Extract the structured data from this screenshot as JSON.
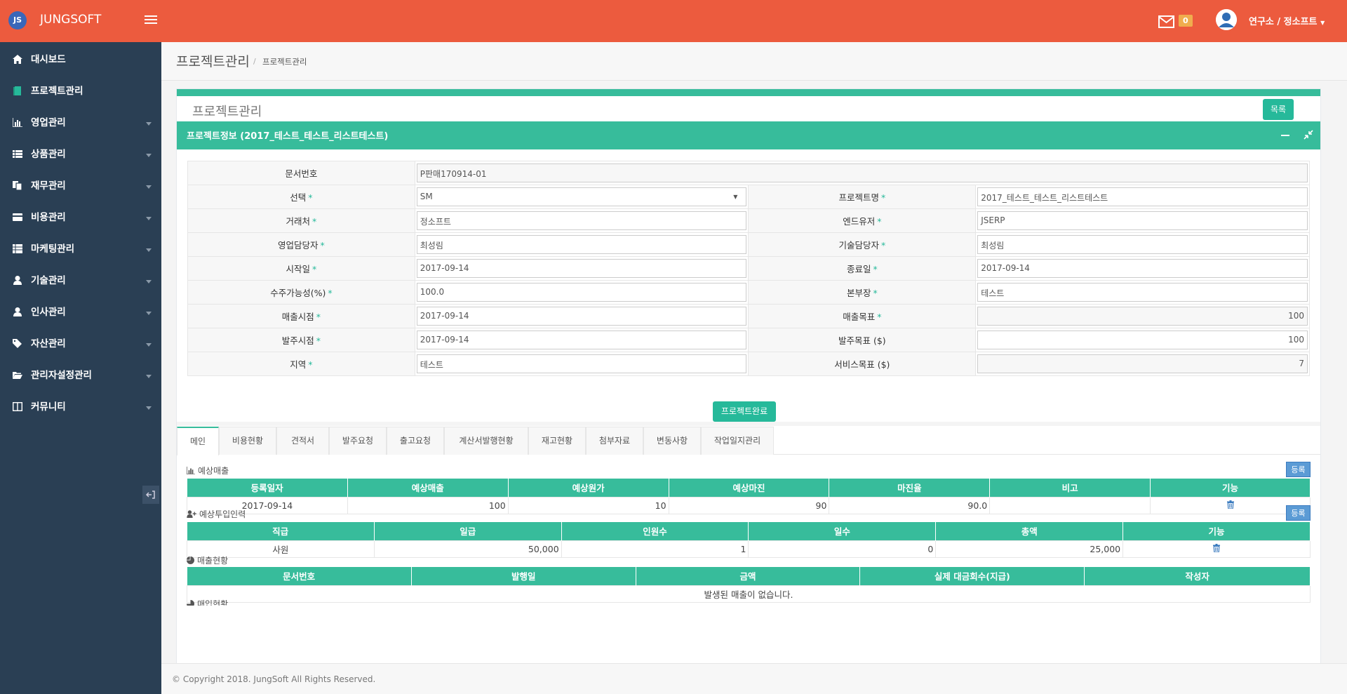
{
  "brand": {
    "logo": "JS",
    "name": "JUNGSOFT"
  },
  "topbar": {
    "mail_count": "0",
    "user": "연구소 / 정소프트"
  },
  "sidebar": {
    "items": [
      {
        "label": "대시보드",
        "icon": "home-icon"
      },
      {
        "label": "프로젝트관리",
        "icon": "book-icon"
      },
      {
        "label": "영업관리",
        "icon": "bar-chart-icon"
      },
      {
        "label": "상품관리",
        "icon": "list-icon"
      },
      {
        "label": "재무관리",
        "icon": "files-icon"
      },
      {
        "label": "비용관리",
        "icon": "credit-card-icon"
      },
      {
        "label": "마케팅관리",
        "icon": "table-icon"
      },
      {
        "label": "기술관리",
        "icon": "user-icon"
      },
      {
        "label": "인사관리",
        "icon": "user-icon"
      },
      {
        "label": "자산관리",
        "icon": "tags-icon"
      },
      {
        "label": "관리자설정관리",
        "icon": "folder-open-icon"
      },
      {
        "label": "커뮤니티",
        "icon": "columns-icon"
      }
    ]
  },
  "header": {
    "title": "프로젝트관리",
    "breadcrumb": "프로젝트관리"
  },
  "panel": {
    "title": "프로젝트관리",
    "list_button": "목록",
    "info_title": "프로젝트정보 (2017_테스트_테스트_리스트테스트)",
    "complete_button": "프로젝트완료"
  },
  "form": {
    "doc_no": {
      "label": "문서번호",
      "value": "P판매170914-01"
    },
    "select": {
      "label": "선택",
      "value": "SM"
    },
    "project_name": {
      "label": "프로젝트명",
      "value": "2017_테스트_테스트_리스트테스트"
    },
    "client": {
      "label": "거래처",
      "value": "정소프트"
    },
    "end_user": {
      "label": "엔드유저",
      "value": "JSERP"
    },
    "sales_manager": {
      "label": "영업담당자",
      "value": "최성림"
    },
    "tech_manager": {
      "label": "기술담당자",
      "value": "최성림"
    },
    "start_date": {
      "label": "시작일",
      "value": "2017-09-14"
    },
    "end_date": {
      "label": "종료일",
      "value": "2017-09-14"
    },
    "probability": {
      "label": "수주가능성(%)",
      "value": "100.0"
    },
    "division_head": {
      "label": "본부장",
      "value": "테스트"
    },
    "sales_date": {
      "label": "매출시점",
      "value": "2017-09-14"
    },
    "sales_target": {
      "label": "매출목표",
      "value": "100"
    },
    "order_date": {
      "label": "발주시점",
      "value": "2017-09-14"
    },
    "order_target": {
      "label": "발주목표 ($)",
      "value": "100"
    },
    "region": {
      "label": "지역",
      "value": "테스트"
    },
    "service_target": {
      "label": "서비스목표 ($)",
      "value": "7"
    }
  },
  "tabs": [
    "메인",
    "비용현황",
    "견적서",
    "발주요청",
    "출고요청",
    "계산서발행현황",
    "재고현황",
    "첨부자료",
    "변동사항",
    "작업일지관리"
  ],
  "expected_sales": {
    "title": "예상매출",
    "register": "등록",
    "columns": [
      "등록일자",
      "예상매출",
      "예상원가",
      "예상마진",
      "마진율",
      "비고",
      "기능"
    ],
    "rows": [
      [
        "2017-09-14",
        "100",
        "10",
        "90",
        "90.0",
        ""
      ]
    ]
  },
  "expected_staff": {
    "title": "예상투입인력",
    "register": "등록",
    "columns": [
      "직급",
      "일급",
      "인원수",
      "일수",
      "총액",
      "기능"
    ],
    "rows": [
      [
        "사원",
        "50,000",
        "1",
        "0",
        "25,000"
      ]
    ]
  },
  "sales_status": {
    "title": "매출현황",
    "columns": [
      "문서번호",
      "발행일",
      "금액",
      "실제 대금회수(지급)",
      "작성자"
    ],
    "empty": "발생된 매출이 없습니다."
  },
  "next_section": {
    "title": "매입현황"
  },
  "footer": {
    "copyright": "© Copyright 2018. JungSoft All Rights Reserved."
  },
  "colors": {
    "topbar": "#ec5b3e",
    "sidebar": "#2a3f54",
    "accent": "#37bc9b",
    "badge": "#f0ad4e"
  }
}
